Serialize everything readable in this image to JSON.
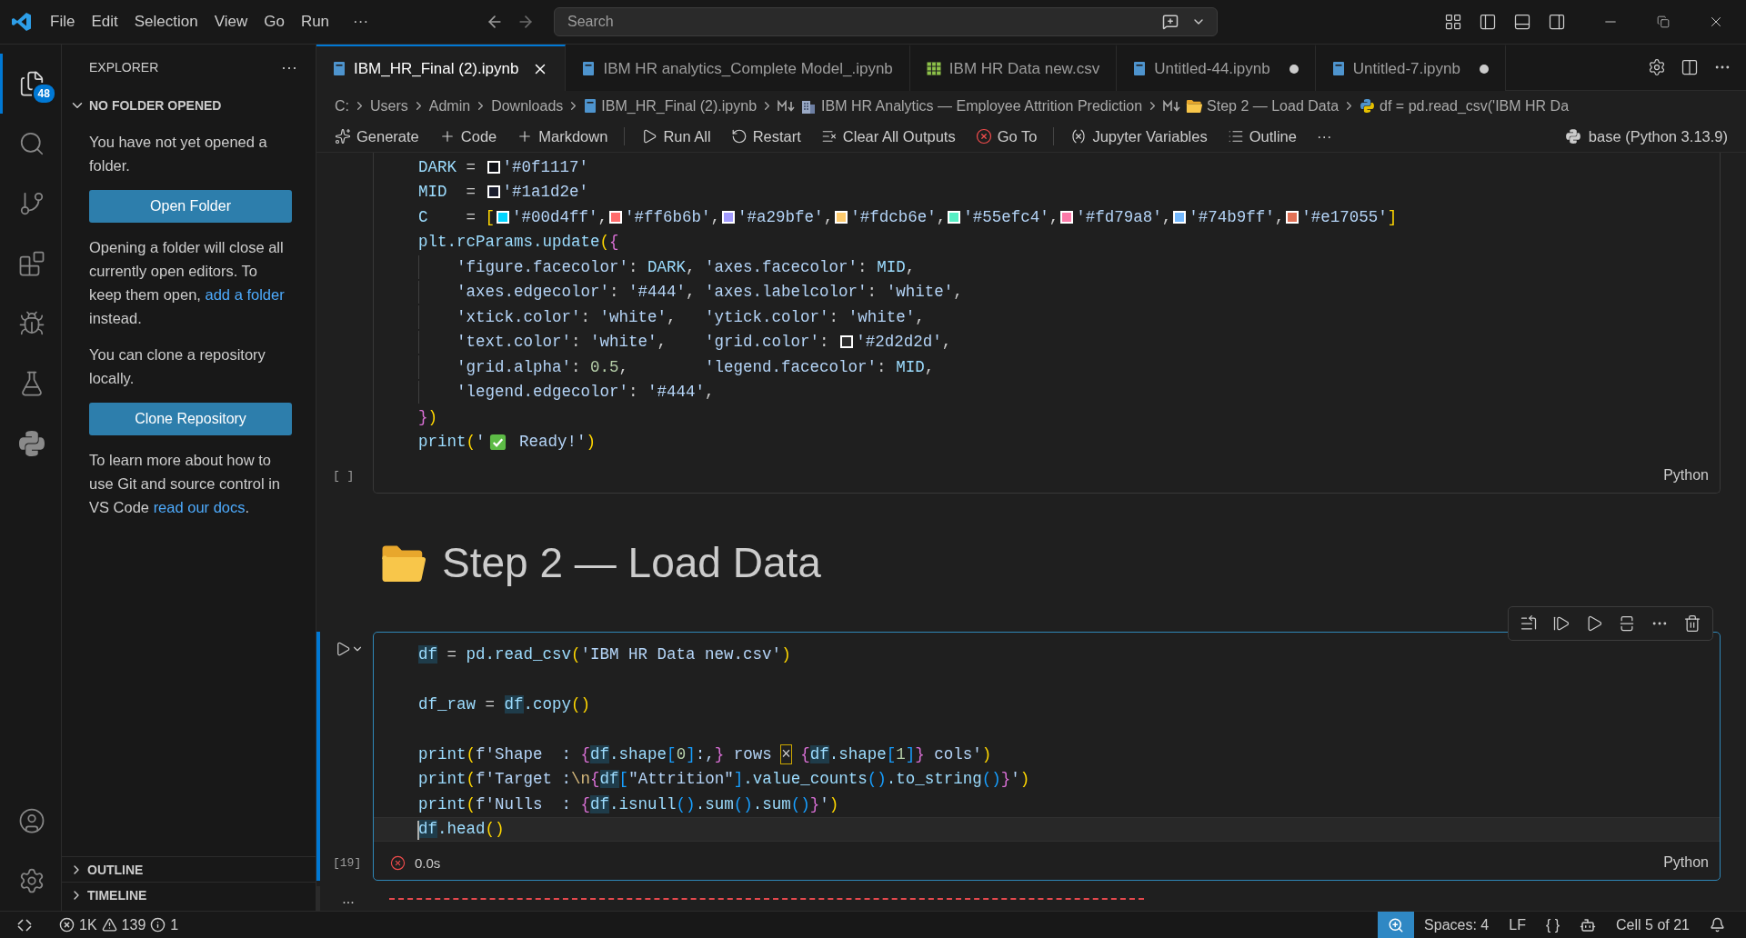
{
  "title_bar": {
    "menu": [
      "File",
      "Edit",
      "Selection",
      "View",
      "Go",
      "Run"
    ],
    "more": "···",
    "search": {
      "placeholder": "Search"
    }
  },
  "activity_bar": {
    "items": [
      {
        "kind": "files",
        "selected": true,
        "badge": "48"
      },
      {
        "kind": "search",
        "selected": false
      },
      {
        "kind": "source-control",
        "selected": false
      },
      {
        "kind": "extensions",
        "selected": false
      },
      {
        "kind": "run-debug",
        "selected": false
      },
      {
        "kind": "testing",
        "selected": false
      },
      {
        "kind": "python",
        "selected": false
      }
    ]
  },
  "sidebar": {
    "title": "EXPLORER",
    "more": "···",
    "section": {
      "title": "NO FOLDER OPENED",
      "expanded": true
    },
    "blocks": [
      {
        "kind": "text",
        "parts": [
          {
            "text": "You have not yet opened a folder.",
            "link": false
          }
        ]
      },
      {
        "kind": "button",
        "label": "Open Folder"
      },
      {
        "kind": "text",
        "parts": [
          {
            "text": "Opening a folder will close all currently open editors. To keep them open, ",
            "link": false
          },
          {
            "text": "add a folder",
            "link": true
          },
          {
            "text": " instead.",
            "link": false
          }
        ]
      },
      {
        "kind": "text",
        "parts": [
          {
            "text": "You can clone a repository locally.",
            "link": false
          }
        ]
      },
      {
        "kind": "button",
        "label": "Clone Repository"
      },
      {
        "kind": "text",
        "parts": [
          {
            "text": "To learn more about how to use Git and source control in VS Code ",
            "link": false
          },
          {
            "text": "read our docs",
            "link": true
          },
          {
            "text": ".",
            "link": false
          }
        ]
      }
    ],
    "collapsed": [
      {
        "title": "OUTLINE",
        "expanded": false
      },
      {
        "title": "TIMELINE",
        "expanded": false
      }
    ]
  },
  "tabs": [
    {
      "label": "IBM_HR_Final (2).ipynb",
      "kind": "notebook",
      "selected": true,
      "modified": false
    },
    {
      "label": "IBM HR analytics_Complete Model_.ipynb",
      "kind": "notebook",
      "selected": false,
      "modified": false
    },
    {
      "label": "IBM HR Data new.csv",
      "kind": "csv",
      "selected": false,
      "modified": false
    },
    {
      "label": "Untitled-44.ipynb",
      "kind": "notebook",
      "selected": false,
      "modified": true
    },
    {
      "label": "Untitled-7.ipynb",
      "kind": "notebook",
      "selected": false,
      "modified": true
    }
  ],
  "breadcrumbs": [
    {
      "label": "C:",
      "kind": "plain"
    },
    {
      "label": "Users",
      "kind": "plain"
    },
    {
      "label": "Admin",
      "kind": "plain"
    },
    {
      "label": "Downloads",
      "kind": "plain"
    },
    {
      "label": "IBM_HR_Final (2).ipynb",
      "kind": "notebook"
    },
    {
      "label": "IBM HR Analytics — Employee Attrition Prediction",
      "kind": "heading-building"
    },
    {
      "label": "Step 2 — Load Data",
      "kind": "heading-folder"
    },
    {
      "label": "df = pd.read_csv('IBM HR Da",
      "kind": "python"
    }
  ],
  "notebook_toolbar": {
    "groups": [
      [
        {
          "label": "Generate",
          "kind": "generate"
        },
        {
          "label": "Code",
          "kind": "add"
        },
        {
          "label": "Markdown",
          "kind": "add"
        }
      ],
      [
        {
          "label": "Run All",
          "kind": "run"
        },
        {
          "label": "Restart",
          "kind": "restart"
        },
        {
          "label": "Clear All Outputs",
          "kind": "clear"
        },
        {
          "label": "Go To",
          "kind": "goto"
        }
      ],
      [
        {
          "label": "Jupyter Variables",
          "kind": "variables"
        },
        {
          "label": "Outline",
          "kind": "outline"
        }
      ]
    ],
    "more": "···",
    "kernel": "base (Python 3.13.9)"
  },
  "cells": [
    {
      "kind": "code",
      "count": "[ ]",
      "language": "Python",
      "focused": false,
      "lines": [
        {
          "kind": "code",
          "current": false,
          "tokens": [
            {
              "kind": "name",
              "text": "DARK"
            },
            {
              "kind": "op",
              "text": " = "
            },
            {
              "kind": "swatch",
              "color": "#0f1117"
            },
            {
              "kind": "str",
              "text": "'#0f1117'"
            }
          ]
        },
        {
          "kind": "code",
          "current": false,
          "tokens": [
            {
              "kind": "name",
              "text": "MID"
            },
            {
              "kind": "op",
              "text": "  = "
            },
            {
              "kind": "swatch",
              "color": "#1a1d2e"
            },
            {
              "kind": "str",
              "text": "'#1a1d2e'"
            }
          ]
        },
        {
          "kind": "code",
          "current": false,
          "tokens": [
            {
              "kind": "name",
              "text": "C"
            },
            {
              "kind": "op",
              "text": "    = "
            },
            {
              "kind": "b1",
              "text": "["
            },
            {
              "kind": "swatch",
              "color": "#00d4ff"
            },
            {
              "kind": "str",
              "text": "'#00d4ff'"
            },
            {
              "kind": "op",
              "text": ","
            },
            {
              "kind": "swatch",
              "color": "#ff6b6b"
            },
            {
              "kind": "str",
              "text": "'#ff6b6b'"
            },
            {
              "kind": "op",
              "text": ","
            },
            {
              "kind": "swatch",
              "color": "#a29bfe"
            },
            {
              "kind": "str",
              "text": "'#a29bfe'"
            },
            {
              "kind": "op",
              "text": ","
            },
            {
              "kind": "swatch",
              "color": "#fdcb6e"
            },
            {
              "kind": "str",
              "text": "'#fdcb6e'"
            },
            {
              "kind": "op",
              "text": ","
            },
            {
              "kind": "swatch",
              "color": "#55efc4"
            },
            {
              "kind": "str",
              "text": "'#55efc4'"
            },
            {
              "kind": "op",
              "text": ","
            },
            {
              "kind": "swatch",
              "color": "#fd79a8"
            },
            {
              "kind": "str",
              "text": "'#fd79a8'"
            },
            {
              "kind": "op",
              "text": ","
            },
            {
              "kind": "swatch",
              "color": "#74b9ff"
            },
            {
              "kind": "str",
              "text": "'#74b9ff'"
            },
            {
              "kind": "op",
              "text": ","
            },
            {
              "kind": "swatch",
              "color": "#e17055"
            },
            {
              "kind": "str",
              "text": "'#e17055'"
            },
            {
              "kind": "b1",
              "text": "]"
            }
          ]
        },
        {
          "kind": "code",
          "current": false,
          "tokens": [
            {
              "kind": "name",
              "text": "plt.rcParams.update"
            },
            {
              "kind": "b1",
              "text": "("
            },
            {
              "kind": "b2",
              "text": "{"
            }
          ]
        },
        {
          "kind": "indented",
          "current": false,
          "tokens": [
            {
              "kind": "str",
              "text": "'figure.facecolor'"
            },
            {
              "kind": "op",
              "text": ": "
            },
            {
              "kind": "name",
              "text": "DARK"
            },
            {
              "kind": "op",
              "text": ", "
            },
            {
              "kind": "str",
              "text": "'axes.facecolor'"
            },
            {
              "kind": "op",
              "text": ": "
            },
            {
              "kind": "name",
              "text": "MID"
            },
            {
              "kind": "op",
              "text": ","
            }
          ]
        },
        {
          "kind": "indented",
          "current": false,
          "tokens": [
            {
              "kind": "str",
              "text": "'axes.edgecolor'"
            },
            {
              "kind": "op",
              "text": ": "
            },
            {
              "kind": "str",
              "text": "'#444'"
            },
            {
              "kind": "op",
              "text": ", "
            },
            {
              "kind": "str",
              "text": "'axes.labelcolor'"
            },
            {
              "kind": "op",
              "text": ": "
            },
            {
              "kind": "str",
              "text": "'white'"
            },
            {
              "kind": "op",
              "text": ","
            }
          ]
        },
        {
          "kind": "indented",
          "current": false,
          "tokens": [
            {
              "kind": "str",
              "text": "'xtick.color'"
            },
            {
              "kind": "op",
              "text": ": "
            },
            {
              "kind": "str",
              "text": "'white'"
            },
            {
              "kind": "op",
              "text": ",   "
            },
            {
              "kind": "str",
              "text": "'ytick.color'"
            },
            {
              "kind": "op",
              "text": ": "
            },
            {
              "kind": "str",
              "text": "'white'"
            },
            {
              "kind": "op",
              "text": ","
            }
          ]
        },
        {
          "kind": "indented",
          "current": false,
          "tokens": [
            {
              "kind": "str",
              "text": "'text.color'"
            },
            {
              "kind": "op",
              "text": ": "
            },
            {
              "kind": "str",
              "text": "'white'"
            },
            {
              "kind": "op",
              "text": ",    "
            },
            {
              "kind": "str",
              "text": "'grid.color'"
            },
            {
              "kind": "op",
              "text": ": "
            },
            {
              "kind": "swatch",
              "color": "#2d2d2d"
            },
            {
              "kind": "str",
              "text": "'#2d2d2d'"
            },
            {
              "kind": "op",
              "text": ","
            }
          ]
        },
        {
          "kind": "indented",
          "current": false,
          "tokens": [
            {
              "kind": "str",
              "text": "'grid.alpha'"
            },
            {
              "kind": "op",
              "text": ": "
            },
            {
              "kind": "num",
              "text": "0.5"
            },
            {
              "kind": "op",
              "text": ",        "
            },
            {
              "kind": "str",
              "text": "'legend.facecolor'"
            },
            {
              "kind": "op",
              "text": ": "
            },
            {
              "kind": "name",
              "text": "MID"
            },
            {
              "kind": "op",
              "text": ","
            }
          ]
        },
        {
          "kind": "indented",
          "current": false,
          "tokens": [
            {
              "kind": "str",
              "text": "'legend.edgecolor'"
            },
            {
              "kind": "op",
              "text": ": "
            },
            {
              "kind": "str",
              "text": "'#444'"
            },
            {
              "kind": "op",
              "text": ","
            }
          ]
        },
        {
          "kind": "code",
          "current": false,
          "tokens": [
            {
              "kind": "b2",
              "text": "}"
            },
            {
              "kind": "b1",
              "text": ")"
            }
          ]
        },
        {
          "kind": "code",
          "current": false,
          "tokens": [
            {
              "kind": "name",
              "text": "print"
            },
            {
              "kind": "b1",
              "text": "("
            },
            {
              "kind": "str",
              "text": "'"
            },
            {
              "kind": "check"
            },
            {
              "kind": "str",
              "text": " Ready!'"
            },
            {
              "kind": "b1",
              "text": ")"
            }
          ]
        }
      ]
    },
    {
      "kind": "markdown",
      "heading": "Step 2 — Load Data"
    },
    {
      "kind": "code",
      "count": "[19]",
      "language": "Python",
      "focused": true,
      "failed": true,
      "duration": "0.0s",
      "lines": [
        {
          "kind": "code",
          "current": false,
          "tokens": [
            {
              "kind": "hl-name",
              "text": "df"
            },
            {
              "kind": "op",
              "text": " = "
            },
            {
              "kind": "name",
              "text": "pd.read_csv"
            },
            {
              "kind": "b1",
              "text": "("
            },
            {
              "kind": "str",
              "text": "'IBM HR Data new.csv'"
            },
            {
              "kind": "b1",
              "text": ")"
            }
          ]
        },
        {
          "kind": "blank",
          "current": false
        },
        {
          "kind": "code",
          "current": false,
          "tokens": [
            {
              "kind": "name",
              "text": "df_raw"
            },
            {
              "kind": "op",
              "text": " = "
            },
            {
              "kind": "hl-name",
              "text": "df"
            },
            {
              "kind": "name",
              "text": ".copy"
            },
            {
              "kind": "b1",
              "text": "()"
            }
          ]
        },
        {
          "kind": "blank",
          "current": false
        },
        {
          "kind": "code",
          "current": false,
          "tokens": [
            {
              "kind": "name",
              "text": "print"
            },
            {
              "kind": "b1",
              "text": "("
            },
            {
              "kind": "str",
              "text": "f'Shape  : "
            },
            {
              "kind": "b2",
              "text": "{"
            },
            {
              "kind": "hl-name",
              "text": "df"
            },
            {
              "kind": "name",
              "text": ".shape"
            },
            {
              "kind": "b3",
              "text": "["
            },
            {
              "kind": "num",
              "text": "0"
            },
            {
              "kind": "b3",
              "text": "]"
            },
            {
              "kind": "str",
              "text": ":,"
            },
            {
              "kind": "b2",
              "text": "}"
            },
            {
              "kind": "str",
              "text": " rows "
            },
            {
              "kind": "warn",
              "text": "×"
            },
            {
              "kind": "b2",
              "text": " {"
            },
            {
              "kind": "hl-name",
              "text": "df"
            },
            {
              "kind": "name",
              "text": ".shape"
            },
            {
              "kind": "b3",
              "text": "["
            },
            {
              "kind": "num",
              "text": "1"
            },
            {
              "kind": "b3",
              "text": "]"
            },
            {
              "kind": "b2",
              "text": "}"
            },
            {
              "kind": "str",
              "text": " cols'"
            },
            {
              "kind": "b1",
              "text": ")"
            }
          ]
        },
        {
          "kind": "code",
          "current": false,
          "tokens": [
            {
              "kind": "name",
              "text": "print"
            },
            {
              "kind": "b1",
              "text": "("
            },
            {
              "kind": "str",
              "text": "f'Target :"
            },
            {
              "kind": "esc",
              "text": "\\n"
            },
            {
              "kind": "b2",
              "text": "{"
            },
            {
              "kind": "hl-name",
              "text": "df"
            },
            {
              "kind": "b3",
              "text": "["
            },
            {
              "kind": "str",
              "text": "\"Attrition\""
            },
            {
              "kind": "b3",
              "text": "]"
            },
            {
              "kind": "name",
              "text": ".value_counts"
            },
            {
              "kind": "b3",
              "text": "()"
            },
            {
              "kind": "name",
              "text": ".to_string"
            },
            {
              "kind": "b3",
              "text": "()"
            },
            {
              "kind": "b2",
              "text": "}"
            },
            {
              "kind": "str",
              "text": "'"
            },
            {
              "kind": "b1",
              "text": ")"
            }
          ]
        },
        {
          "kind": "code",
          "current": false,
          "tokens": [
            {
              "kind": "name",
              "text": "print"
            },
            {
              "kind": "b1",
              "text": "("
            },
            {
              "kind": "str",
              "text": "f'Nulls  : "
            },
            {
              "kind": "b2",
              "text": "{"
            },
            {
              "kind": "hl-name",
              "text": "df"
            },
            {
              "kind": "name",
              "text": ".isnull"
            },
            {
              "kind": "b3",
              "text": "()"
            },
            {
              "kind": "name",
              "text": ".sum"
            },
            {
              "kind": "b3",
              "text": "()"
            },
            {
              "kind": "name",
              "text": ".sum"
            },
            {
              "kind": "b3",
              "text": "()"
            },
            {
              "kind": "b2",
              "text": "}"
            },
            {
              "kind": "str",
              "text": "'"
            },
            {
              "kind": "b1",
              "text": ")"
            }
          ]
        },
        {
          "kind": "code",
          "current": true,
          "tokens": [
            {
              "kind": "hl-name",
              "text": "df"
            },
            {
              "kind": "name",
              "text": ".head"
            },
            {
              "kind": "b1",
              "text": "()"
            }
          ]
        }
      ]
    },
    {
      "kind": "collapsed",
      "marker": "..."
    }
  ],
  "status_bar": {
    "problems": {
      "errors": "1K",
      "warnings": "139",
      "info": "1"
    },
    "items": [
      {
        "kind": "zoom",
        "highlighted": true
      },
      {
        "kind": "text",
        "label": "Spaces: 4"
      },
      {
        "kind": "text",
        "label": "LF"
      },
      {
        "kind": "text",
        "label": "{ }"
      },
      {
        "kind": "copilot"
      },
      {
        "kind": "text",
        "label": "Cell 5 of 21"
      },
      {
        "kind": "bell"
      }
    ]
  }
}
